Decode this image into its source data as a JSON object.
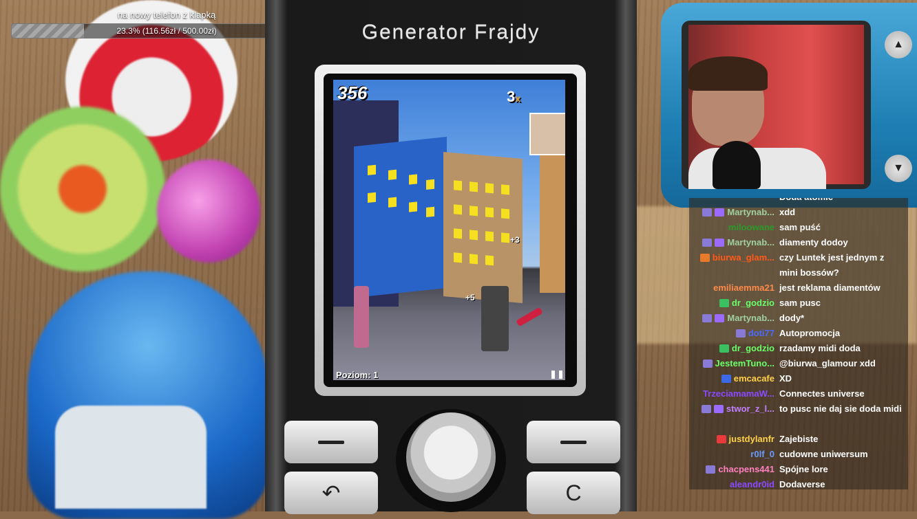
{
  "goal": {
    "title": "na nowy telefon z klapką",
    "progress_text": "23.3% (116.56zł / 500.00zł)",
    "progress_fraction": 0.233
  },
  "phone": {
    "brand": "Generator Frajdy",
    "back_key_icon": "back-arrow-icon",
    "clear_key_label": "C"
  },
  "game": {
    "score": "356",
    "multiplier": "3",
    "multiplier_suffix": "x",
    "level_text": "Poziom: 1",
    "points_popups": [
      "+3",
      "+5"
    ]
  },
  "chat": {
    "colors": {
      "accent_purple": "#9b6bff",
      "accent_green": "#5fd35f",
      "accent_orange": "#ff6a1a"
    },
    "messages": [
      {
        "user": "",
        "text": "Doda atomic",
        "color": "#9fa0ff",
        "badges": []
      },
      {
        "user": "Martynab...",
        "text": "xdd",
        "color": "#9fd0a0",
        "badges": [
          "sub",
          "bits"
        ]
      },
      {
        "user": "miloowane",
        "text": "sam puść",
        "color": "#2a9a2a",
        "badges": []
      },
      {
        "user": "Martynab...",
        "text": "diamenty dodoy",
        "color": "#9fd0a0",
        "badges": [
          "sub",
          "bits"
        ]
      },
      {
        "user": "biurwa_glam...",
        "text": "czy Luntek jest jednym z mini bossów?",
        "color": "#ff5a1a",
        "badges": [
          "fox"
        ]
      },
      {
        "user": "emiliaemma21",
        "text": "jest reklama diamentów",
        "color": "#ff8a4a",
        "badges": []
      },
      {
        "user": "dr_godzio",
        "text": "sam pusc",
        "color": "#6aff6a",
        "badges": [
          "green"
        ]
      },
      {
        "user": "Martynab...",
        "text": "dody*",
        "color": "#9fd0a0",
        "badges": [
          "sub",
          "bits"
        ]
      },
      {
        "user": "doti77",
        "text": "Autopromocja",
        "color": "#4a6aff",
        "badges": [
          "sub"
        ]
      },
      {
        "user": "dr_godzio",
        "text": "rzadamy midi doda",
        "color": "#6aff6a",
        "badges": [
          "green"
        ]
      },
      {
        "user": "JestemTuno...",
        "text": "@biurwa_glamour xdd",
        "color": "#6aff6a",
        "badges": [
          "sub"
        ]
      },
      {
        "user": "emcacafe",
        "text": "XD",
        "color": "#ffd04a",
        "badges": [
          "blue"
        ]
      },
      {
        "user": "TrzeciamamaW...",
        "text": "Connectes universe",
        "color": "#8a4aff",
        "badges": []
      },
      {
        "user": "stwor_z_l...",
        "text": "to pusc nie daj sie doda midi",
        "color": "#c080ff",
        "badges": [
          "sub",
          "bits"
        ]
      },
      {
        "user": "justdylanfr",
        "text": "Zajebiste",
        "color": "#ffd04a",
        "badges": [
          "red"
        ]
      },
      {
        "user": "r0lf_0",
        "text": "cudowne uniwersum",
        "color": "#6a9aff",
        "badges": []
      },
      {
        "user": "chacpens441",
        "text": "Spójne lore",
        "color": "#ff80c0",
        "badges": [
          "sub"
        ]
      },
      {
        "user": "aleandr0id",
        "text": "Dodaverse",
        "color": "#8a4aff",
        "badges": []
      }
    ]
  }
}
